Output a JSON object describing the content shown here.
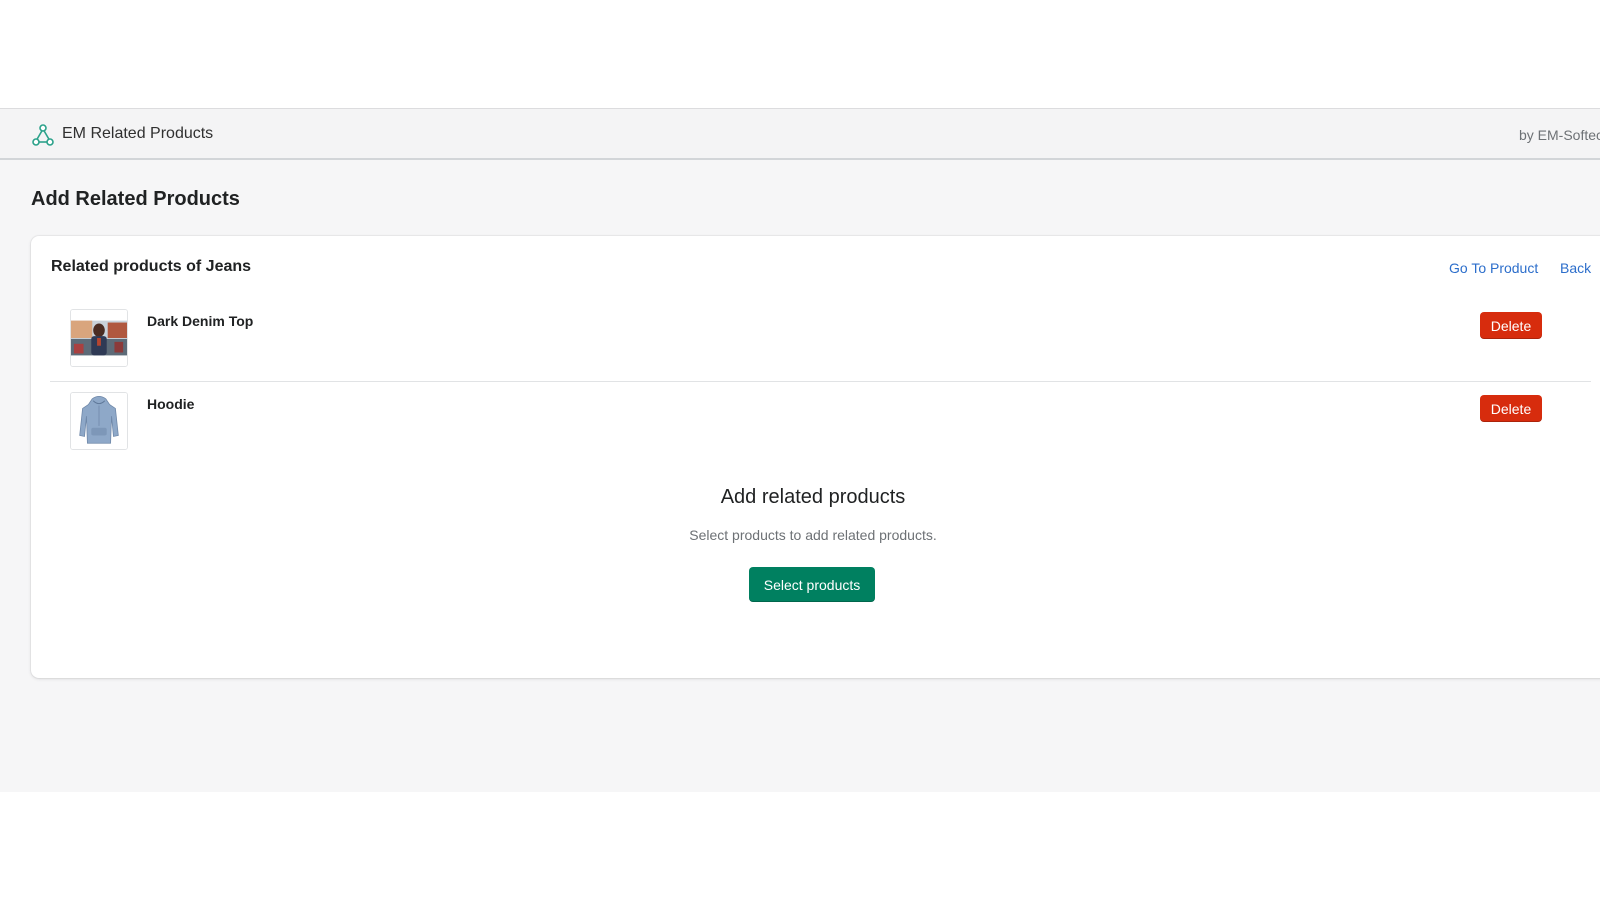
{
  "topbar": {
    "app_name": "EM Related Products",
    "vendor": "by EM-Softec",
    "logo_icon": "share-network-icon",
    "accent_color": "#2ba18a"
  },
  "page": {
    "title": "Add Related Products"
  },
  "card": {
    "title": "Related products of Jeans",
    "actions": {
      "go_to_product": "Go To Product",
      "back": "Back"
    },
    "products": [
      {
        "name": "Dark Denim Top",
        "delete_label": "Delete",
        "thumbnail": "denim-photo-thumbnail"
      },
      {
        "name": "Hoodie",
        "delete_label": "Delete",
        "thumbnail": "hoodie-photo-thumbnail"
      }
    ],
    "empty_state": {
      "heading": "Add related products",
      "text": "Select products to add related products.",
      "button": "Select products"
    }
  },
  "colors": {
    "delete_button": "#d72c0d",
    "primary_button": "#008060",
    "link": "#2c6ecb",
    "app_background": "#f6f6f7"
  }
}
